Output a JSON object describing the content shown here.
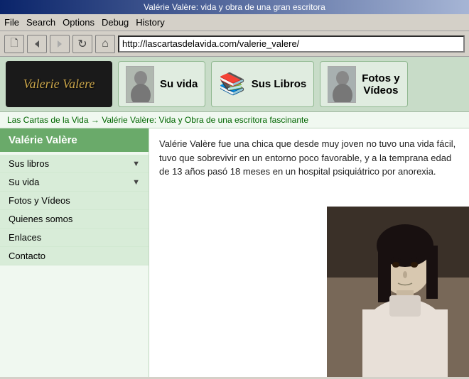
{
  "titlebar": {
    "text": "Valérie Valère: vida y obra de una gran escritora"
  },
  "menubar": {
    "items": [
      {
        "id": "file",
        "label": "File"
      },
      {
        "id": "search",
        "label": "Search"
      },
      {
        "id": "options",
        "label": "Options"
      },
      {
        "id": "debug",
        "label": "Debug"
      },
      {
        "id": "history",
        "label": "History"
      }
    ]
  },
  "toolbar": {
    "buttons": [
      {
        "id": "new",
        "icon": "🗋",
        "label": "New"
      },
      {
        "id": "back",
        "icon": "◀",
        "label": "Back"
      },
      {
        "id": "forward",
        "icon": "▶",
        "label": "Forward"
      },
      {
        "id": "reload",
        "icon": "↻",
        "label": "Reload"
      },
      {
        "id": "home",
        "icon": "⌂",
        "label": "Home"
      }
    ],
    "address": "http://lascartasdelavida.com/valerie_valere/"
  },
  "nav_header": {
    "logo_text": "Valerie Valere",
    "tabs": [
      {
        "id": "su-vida",
        "icon": "👤",
        "label": "Su vida"
      },
      {
        "id": "sus-libros",
        "icon": "📚",
        "label": "Sus Libros"
      },
      {
        "id": "fotos-videos",
        "icon": "👩",
        "label": "Fotos y\nVídeos"
      }
    ]
  },
  "breadcrumb": {
    "items": [
      {
        "label": "Las Cartas de la Vida",
        "href": "#"
      },
      {
        "label": "Valérie Valère: Vida y Obra de una escritora fascinante",
        "href": "#"
      }
    ],
    "separator": "→"
  },
  "sidebar": {
    "title": "Valérie Valère",
    "items": [
      {
        "label": "Sus libros",
        "has_arrow": true
      },
      {
        "label": "Su vida",
        "has_arrow": true
      },
      {
        "label": "Fotos y Vídeos",
        "has_arrow": false
      },
      {
        "label": "Quienes somos",
        "has_arrow": false
      },
      {
        "label": "Enlaces",
        "has_arrow": false
      },
      {
        "label": "Contacto",
        "has_arrow": false
      }
    ]
  },
  "content": {
    "text": "Valérie Valère fue una chica que desde muy joven no tuvo una vida fácil, tuvo que sobrevivir en un entorno poco favorable, y a la temprana edad de 13 años pasó 18 meses en un hospital psiquiátrico por anorexia."
  }
}
